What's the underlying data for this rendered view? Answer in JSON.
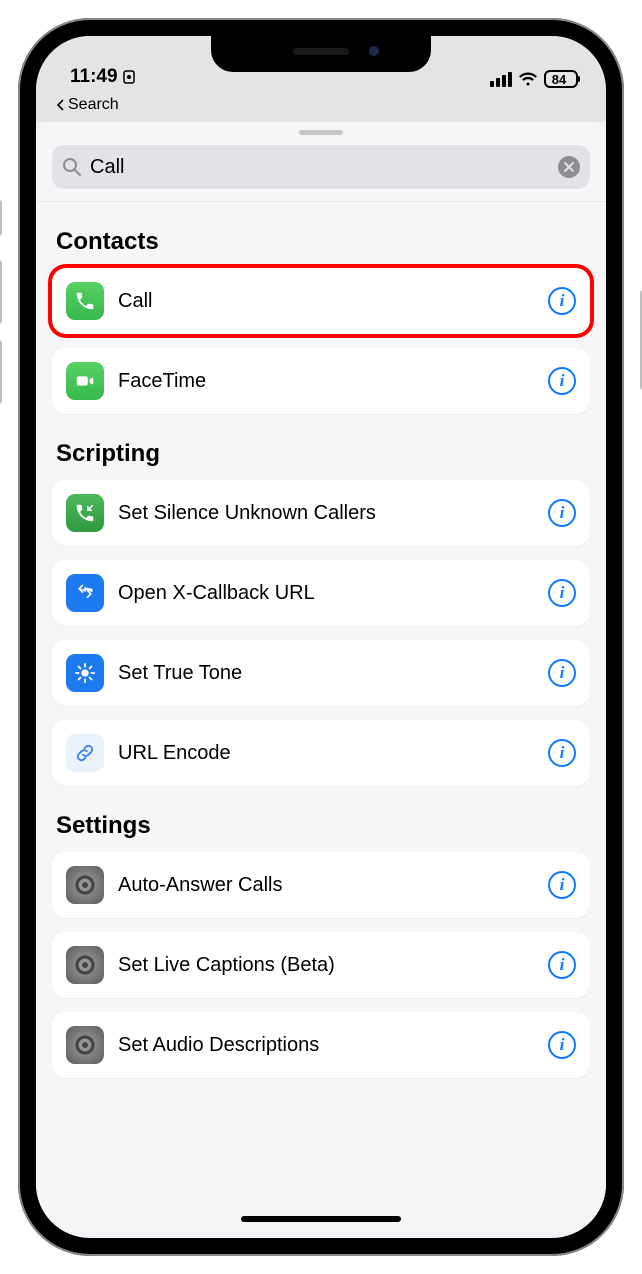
{
  "status": {
    "time": "11:49",
    "battery": "84"
  },
  "nav": {
    "back_label": "Search"
  },
  "search": {
    "value": "Call"
  },
  "sections": {
    "contacts": {
      "title": "Contacts",
      "items": [
        {
          "icon": "phone",
          "label": "Call"
        },
        {
          "icon": "facetime",
          "label": "FaceTime"
        }
      ]
    },
    "scripting": {
      "title": "Scripting",
      "items": [
        {
          "icon": "phone-in",
          "label": "Set Silence Unknown Callers"
        },
        {
          "icon": "x-callback",
          "label": "Open X-Callback URL"
        },
        {
          "icon": "truetone",
          "label": "Set True Tone"
        },
        {
          "icon": "link",
          "label": "URL Encode"
        }
      ]
    },
    "settings": {
      "title": "Settings",
      "items": [
        {
          "icon": "gear",
          "label": "Auto-Answer Calls"
        },
        {
          "icon": "gear",
          "label": "Set Live Captions (Beta)"
        },
        {
          "icon": "gear",
          "label": "Set Audio Descriptions"
        }
      ]
    }
  }
}
